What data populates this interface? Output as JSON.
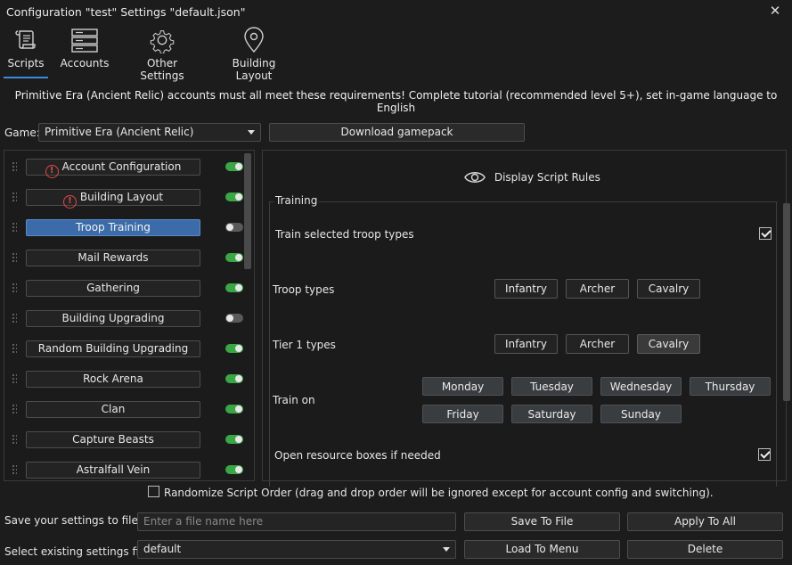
{
  "window": {
    "title": "Configuration \"test\" Settings \"default.json\""
  },
  "nav": {
    "tabs": [
      {
        "label": "Scripts"
      },
      {
        "label": "Accounts"
      },
      {
        "label": "Other Settings"
      },
      {
        "label": "Building Layout"
      }
    ],
    "active": "Scripts"
  },
  "notice": "Primitive Era (Ancient Relic) accounts must all meet these requirements! Complete tutorial (recommended level 5+), set in-game language to English",
  "game": {
    "label": "Game:",
    "selected": "Primitive Era (Ancient Relic)",
    "download_label": "Download gamepack"
  },
  "scripts": [
    {
      "label": "Account Configuration",
      "warning": true,
      "enabled": true,
      "active": false
    },
    {
      "label": "Building Layout",
      "warning": true,
      "enabled": true,
      "active": false
    },
    {
      "label": "Troop Training",
      "warning": false,
      "enabled": false,
      "active": true
    },
    {
      "label": "Mail Rewards",
      "warning": false,
      "enabled": true,
      "active": false
    },
    {
      "label": "Gathering",
      "warning": false,
      "enabled": true,
      "active": false
    },
    {
      "label": "Building Upgrading",
      "warning": false,
      "enabled": false,
      "active": false
    },
    {
      "label": "Random Building Upgrading",
      "warning": false,
      "enabled": true,
      "active": false
    },
    {
      "label": "Rock Arena",
      "warning": false,
      "enabled": true,
      "active": false
    },
    {
      "label": "Clan",
      "warning": false,
      "enabled": true,
      "active": false
    },
    {
      "label": "Capture Beasts",
      "warning": false,
      "enabled": true,
      "active": false
    },
    {
      "label": "Astralfall Vein",
      "warning": false,
      "enabled": true,
      "active": false
    }
  ],
  "script_panel": {
    "rules_label": "Display Script Rules",
    "group_title": "Training",
    "train_selected": {
      "label": "Train selected troop types",
      "checked": true
    },
    "troop_types": {
      "label": "Troop types",
      "options": [
        "Infantry",
        "Archer",
        "Cavalry"
      ]
    },
    "tier1_types": {
      "label": "Tier 1 types",
      "options": [
        "Infantry",
        "Archer",
        "Cavalry"
      ],
      "selected": "Cavalry"
    },
    "train_on": {
      "label": "Train on",
      "days": [
        "Monday",
        "Tuesday",
        "Wednesday",
        "Thursday",
        "Friday",
        "Saturday",
        "Sunday"
      ]
    },
    "open_boxes": {
      "label": "Open resource boxes if needed",
      "checked": true
    }
  },
  "randomize": {
    "label": "Randomize Script Order (drag and drop order will be ignored except for account config and switching).",
    "checked": false
  },
  "save": {
    "label": "Save your settings to file",
    "placeholder": "Enter a file name here",
    "save_button": "Save To File",
    "apply_button": "Apply To All"
  },
  "load": {
    "label": "Select existing settings file",
    "selected": "default",
    "load_button": "Load To Menu",
    "delete_button": "Delete"
  },
  "colors": {
    "accent": "#3d8bd8",
    "toggle_on": "#3aa645",
    "active_script": "#3b6ba8",
    "warning": "#e04848"
  }
}
